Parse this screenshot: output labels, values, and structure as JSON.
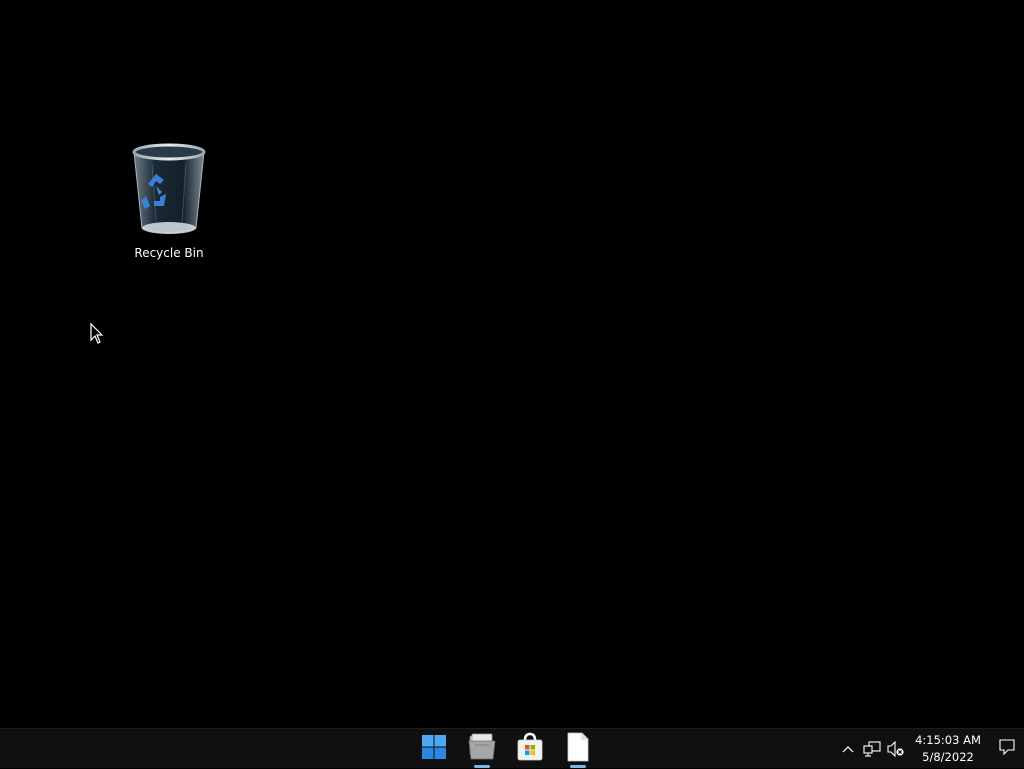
{
  "desktop": {
    "background_color": "#000000",
    "icons": [
      {
        "label": "Recycle Bin",
        "icon": "recycle-bin-icon"
      }
    ]
  },
  "taskbar": {
    "background_color": "#101010",
    "accent_color": "#76b9ed",
    "pinned": [
      {
        "name": "Start",
        "icon": "windows-logo-icon",
        "running": false
      },
      {
        "name": "File Explorer",
        "icon": "file-explorer-icon",
        "running": true
      },
      {
        "name": "Microsoft Store",
        "icon": "store-icon",
        "running": false
      },
      {
        "name": "Notepad",
        "icon": "document-icon",
        "running": true
      }
    ],
    "tray": {
      "icons": [
        "chevron-up-icon",
        "network-icon",
        "volume-muted-icon"
      ],
      "time": "4:15:03 AM",
      "date": "5/8/2022"
    }
  }
}
